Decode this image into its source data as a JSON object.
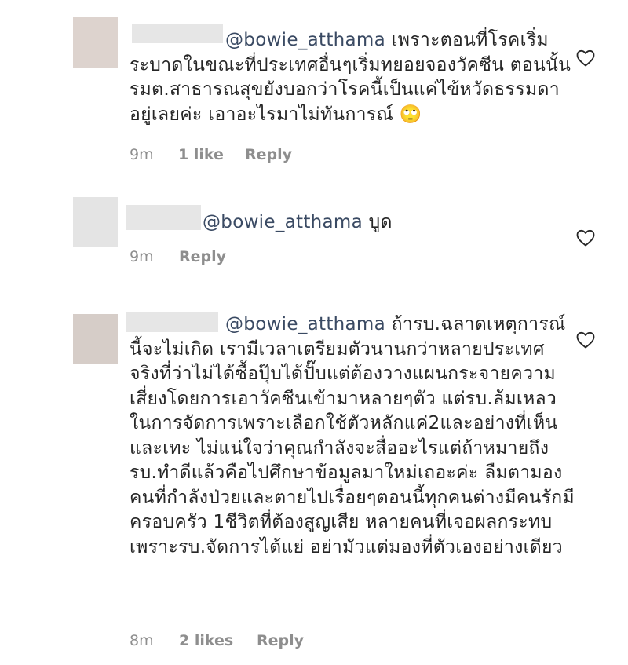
{
  "comments": [
    {
      "mention": "@bowie_atthama",
      "body": " เพราะตอนที่โรคเริ่มระบาดในขณะที่ประเทศอื่นๆเริ่มทยอยจองวัคซีน ตอนนั้นรมต.สาธารณสุขยังบอกว่าโรคนี้เป็นแค่ไข้หวัดธรรมดาอยู่เลยค่ะ เอาอะไรมาไม่ทันการณ์ 🙄",
      "time": "9m",
      "likes": "1 like",
      "reply": "Reply",
      "avatar_color": "#ddd3ce"
    },
    {
      "mention": "@bowie_atthama",
      "body": " บูด",
      "time": "9m",
      "likes": "",
      "reply": "Reply",
      "avatar_color": "#e4e4e4"
    },
    {
      "mention": "@bowie_atthama",
      "body": " ถ้ารบ.ฉลาดเหตุการณ์นี้จะไม่เกิด เรามีเวลาเตรียมตัวนานกว่าหลายประเทศ จริงที่ว่าไม่ได้ซื้อปุ๊บได้ปั๊บแต่ต้องวางแผนกระจายความเสี่ยงโดยการเอาวัคซีนเข้ามาหลายๆตัว แต่รบ.ล้มเหลวในการจัดการเพราะเลือกใช้ตัวหลักแค่2และอย่างที่เห็นและเทะ ไม่แน่ใจว่าคุณกำลังจะสื่ออะไรแต่ถ้าหมายถึงรบ.ทำดีแล้วคือไปศึกษาข้อมูลมาใหม่เถอะค่ะ ลืมตามองคนที่กำลังป่วยและตายไปเรื่อยๆตอนนี้ทุกคนต่างมีคนรักมีครอบครัว 1ชีวิตที่ต้องสูญเสีย หลายคนที่เจอผลกระทบเพราะรบ.จัดการได้แย่ อย่ามัวแต่มองที่ตัวเองอย่างเดียว",
      "time": "8m",
      "likes": "2 likes",
      "reply": "Reply",
      "avatar_color": "#d6cdc8"
    }
  ],
  "icons": {
    "like": "heart-outline-icon"
  },
  "colors": {
    "text": "#262626",
    "meta": "#8e8e8e",
    "mention": "#3a4a63"
  }
}
